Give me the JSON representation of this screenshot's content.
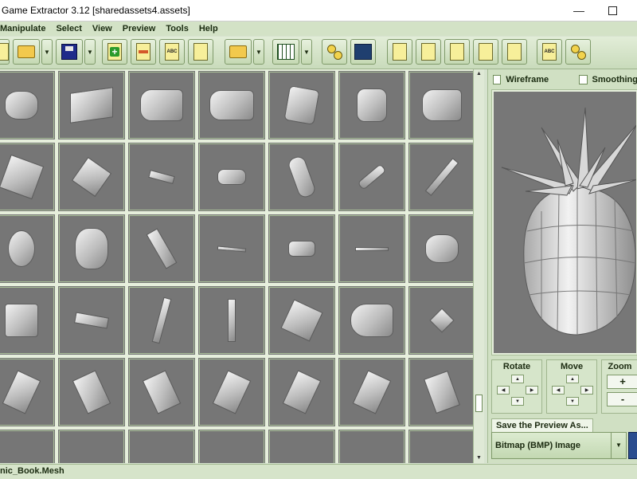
{
  "window": {
    "title": "Game Extractor 3.12 [sharedassets4.assets]",
    "min_glyph": "—",
    "max_glyph": ""
  },
  "menu": [
    "Manipulate",
    "Select",
    "View",
    "Preview",
    "Tools",
    "Help"
  ],
  "toolbar": {
    "buttons": [
      {
        "name": "new-archive-button",
        "icon": "page-icon"
      },
      {
        "name": "open-archive-button",
        "icon": "folder-open-icon"
      },
      {
        "name": "save-archive-button",
        "icon": "floppy-disk-icon"
      },
      {
        "name": "add-files-button",
        "icon": "page-plus-icon"
      },
      {
        "name": "remove-files-button",
        "icon": "page-minus-icon"
      },
      {
        "name": "rename-files-button",
        "icon": "page-abc-icon"
      },
      {
        "name": "replace-files-button",
        "icon": "page-replace-icon"
      },
      {
        "name": "export-files-button",
        "icon": "folder-export-icon"
      },
      {
        "name": "table-view-button",
        "icon": "table-icon"
      },
      {
        "name": "thumbnail-view-button",
        "icon": "thumbnails-icon"
      },
      {
        "name": "details-view-button",
        "icon": "details-table-icon"
      },
      {
        "name": "preview-button",
        "icon": "page-preview-icon"
      },
      {
        "name": "search-button",
        "icon": "magnify-icon"
      },
      {
        "name": "plugins-button",
        "icon": "gear-page-icon"
      },
      {
        "name": "file-info-button",
        "icon": "tree-page-icon"
      },
      {
        "name": "hex-editor-button",
        "icon": "page-info-icon"
      },
      {
        "name": "rename-all-button",
        "icon": "abc-group-icon"
      },
      {
        "name": "options-button",
        "icon": "group-icon"
      }
    ],
    "page_labels": {
      "abc": "ABC"
    }
  },
  "panel": {
    "wireframe_label": "Wireframe",
    "smoothing_label": "Smoothing",
    "rotate_label": "Rotate",
    "move_label": "Move",
    "zoom_label": "Zoom",
    "zoom_in": "+",
    "zoom_out": "-",
    "save_preview_label": "Save the Preview As...",
    "save_format": "Bitmap (BMP) Image"
  },
  "status": {
    "text": "nic_Book.Mesh"
  },
  "colors": {
    "accent_green": "#d3e2c6",
    "preview_bg": "#777777"
  }
}
